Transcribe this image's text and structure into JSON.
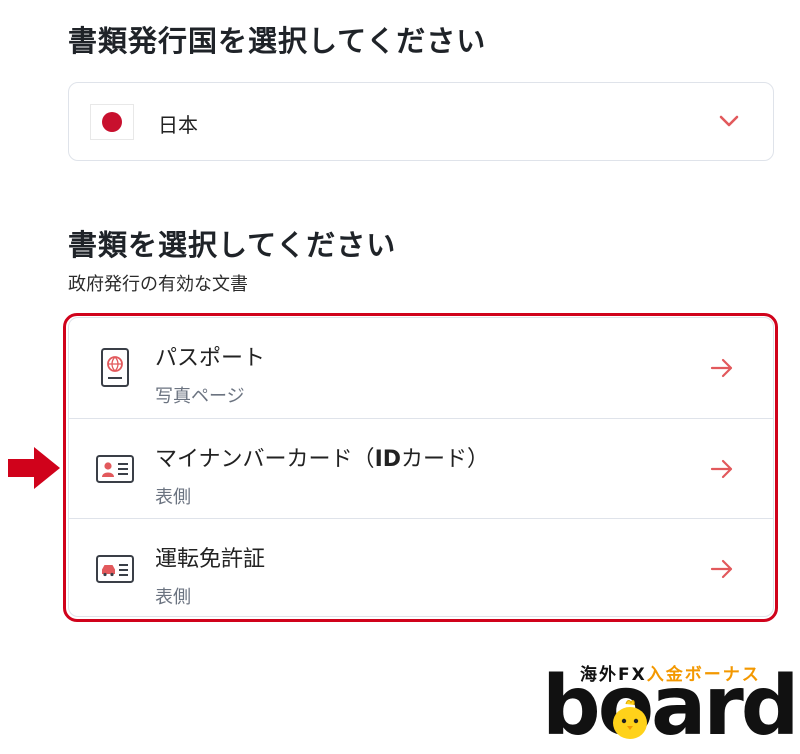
{
  "country_section": {
    "heading": "書類発行国を選択してください",
    "selected_country": "日本"
  },
  "document_section": {
    "heading": "書類を選択してください",
    "subtitle": "政府発行の有効な文書",
    "items": [
      {
        "title": "パスポート",
        "title_bold": "",
        "title_end": "",
        "subtitle": "写真ページ",
        "icon": "passport-icon"
      },
      {
        "title": "マイナンバーカード（",
        "title_bold": "ID",
        "title_end": "カード）",
        "subtitle": "表側",
        "icon": "id-card-icon"
      },
      {
        "title": "運転免許証",
        "title_bold": "",
        "title_end": "",
        "subtitle": "表側",
        "icon": "drivers-license-icon"
      }
    ]
  },
  "logo": {
    "top_text_a": "海外FX",
    "top_text_b": "入金ボーナス",
    "word": "board"
  },
  "colors": {
    "accent": "#e2595c",
    "highlight": "#d0021b",
    "flag_red": "#c8102e",
    "logo_orange": "#f39800"
  }
}
